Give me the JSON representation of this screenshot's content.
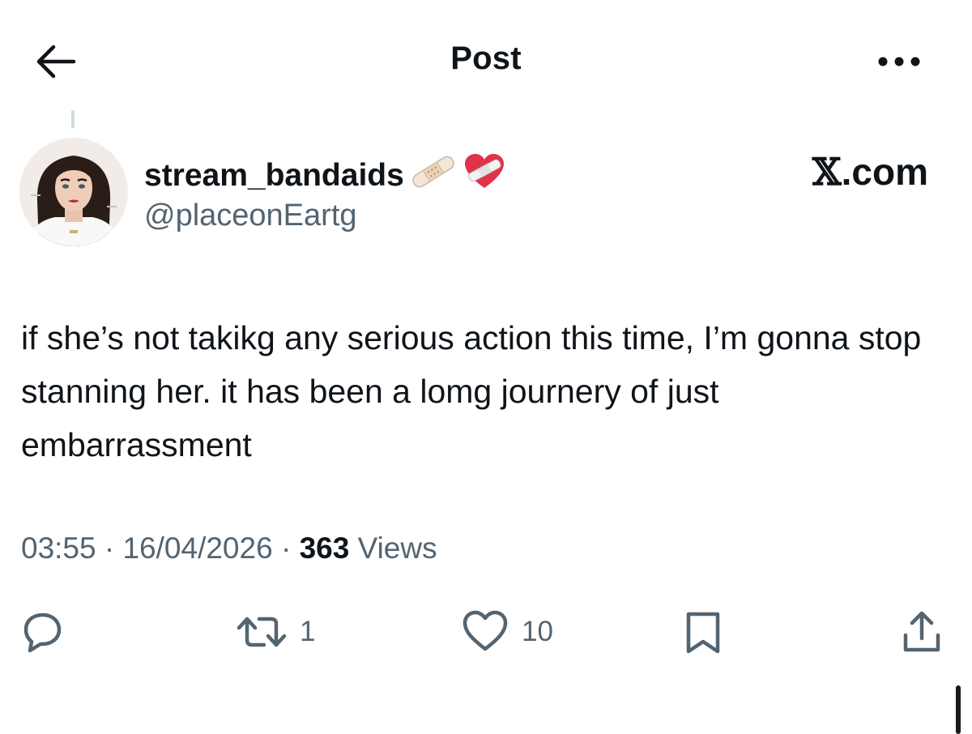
{
  "header": {
    "title": "Post",
    "back_icon": "arrow-left-icon",
    "more_icon": "more-horizontal-icon"
  },
  "author": {
    "display_name": "stream_bandaids",
    "name_emojis": [
      "adhesive-bandage-emoji",
      "mending-heart-emoji"
    ],
    "handle": "@placeonEartg"
  },
  "watermark": {
    "x_glyph": "𝕏",
    "text": ".com"
  },
  "post": {
    "text": "if she’s not takikg any serious action this time, I’m gonna stop stanning her. it has been a lomg journery of just embarrassment"
  },
  "meta": {
    "time": "03:55",
    "separator": " · ",
    "date": "16/04/2026",
    "views_count": "363",
    "views_label": " Views"
  },
  "actions": {
    "reply": {
      "icon": "reply-icon",
      "count": ""
    },
    "repost": {
      "icon": "repost-icon",
      "count": "1"
    },
    "like": {
      "icon": "heart-icon",
      "count": "10"
    },
    "bookmark": {
      "icon": "bookmark-icon",
      "count": ""
    },
    "share": {
      "icon": "share-icon",
      "count": ""
    }
  },
  "colors": {
    "text_primary": "#0f1419",
    "text_secondary": "#536471",
    "background": "#ffffff"
  }
}
